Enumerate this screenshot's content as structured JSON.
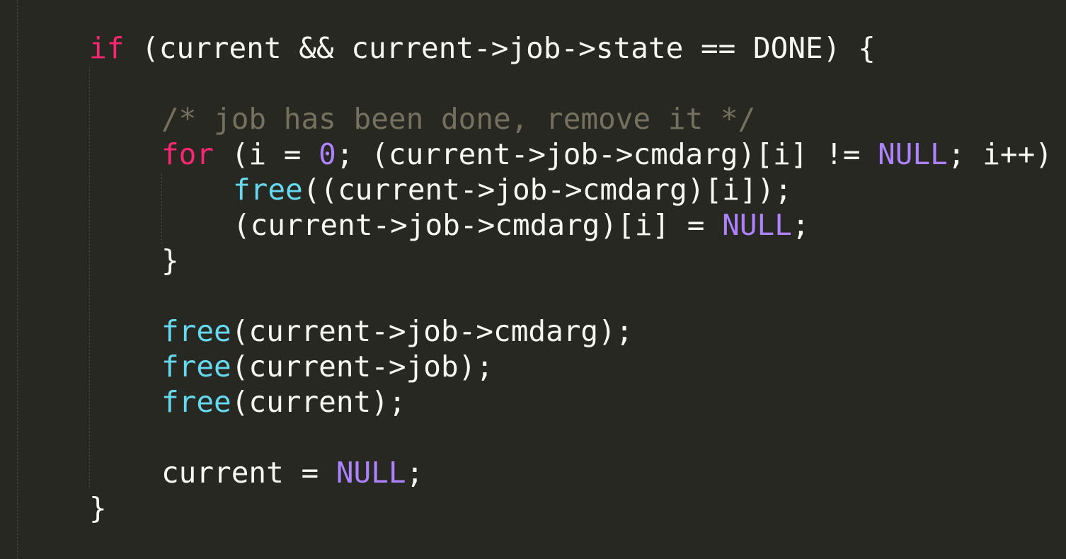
{
  "editor": {
    "theme_colors": {
      "background": "#272822",
      "text": "#f8f8f2",
      "keyword": "#f92672",
      "function": "#66d9ef",
      "constant": "#ae81ff",
      "comment": "#75715e"
    },
    "lines": [
      {
        "tokens": [
          {
            "t": "if",
            "c": "kw"
          },
          {
            "t": " (current && current->job->state == DONE) {",
            "c": ""
          }
        ]
      },
      {
        "tokens": []
      },
      {
        "tokens": [
          {
            "t": "/* job has been done, remove it */",
            "c": "cm"
          }
        ]
      },
      {
        "tokens": [
          {
            "t": "for",
            "c": "kw"
          },
          {
            "t": " (i = ",
            "c": ""
          },
          {
            "t": "0",
            "c": "num"
          },
          {
            "t": "; (current->job->cmdarg)[i] != ",
            "c": ""
          },
          {
            "t": "NULL",
            "c": "const"
          },
          {
            "t": "; i++) {",
            "c": ""
          }
        ]
      },
      {
        "tokens": [
          {
            "t": "free",
            "c": "fn"
          },
          {
            "t": "((current->job->cmdarg)[i]);",
            "c": ""
          }
        ]
      },
      {
        "tokens": [
          {
            "t": "(current->job->cmdarg)[i] = ",
            "c": ""
          },
          {
            "t": "NULL",
            "c": "const"
          },
          {
            "t": ";",
            "c": ""
          }
        ]
      },
      {
        "tokens": [
          {
            "t": "}",
            "c": ""
          }
        ]
      },
      {
        "tokens": []
      },
      {
        "tokens": [
          {
            "t": "free",
            "c": "fn"
          },
          {
            "t": "(current->job->cmdarg);",
            "c": ""
          }
        ]
      },
      {
        "tokens": [
          {
            "t": "free",
            "c": "fn"
          },
          {
            "t": "(current->job);",
            "c": ""
          }
        ]
      },
      {
        "tokens": [
          {
            "t": "free",
            "c": "fn"
          },
          {
            "t": "(current);",
            "c": ""
          }
        ]
      },
      {
        "tokens": []
      },
      {
        "tokens": [
          {
            "t": "current = ",
            "c": ""
          },
          {
            "t": "NULL",
            "c": "const"
          },
          {
            "t": ";",
            "c": ""
          }
        ]
      },
      {
        "tokens": [
          {
            "t": "}",
            "c": ""
          }
        ]
      }
    ]
  }
}
